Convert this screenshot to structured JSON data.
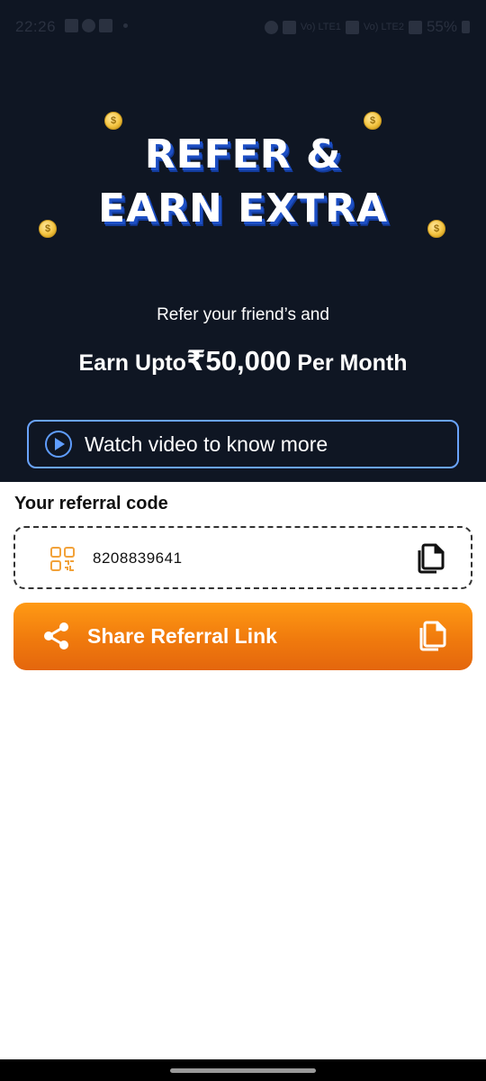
{
  "status_bar": {
    "time": "22:26",
    "battery": "55%",
    "network_labels": [
      "Vo) LTE1",
      "Vo) LTE2"
    ]
  },
  "hero": {
    "headline_line1": "REFER &",
    "headline_line2": "EARN EXTRA",
    "subtitle": "Refer your friend’s and",
    "earn_prefix": "Earn Upto",
    "earn_amount": "₹50,000",
    "earn_suffix": "Per Month",
    "video_button_label": "Watch video to know more",
    "coin_symbol": "$"
  },
  "referral": {
    "title": "Your referral code",
    "code": "8208839641",
    "share_button_label": "Share Referral Link"
  },
  "colors": {
    "hero_background": "#0f1623",
    "accent_blue": "#5f9dff",
    "share_orange": "#f07a0d",
    "qr_icon_orange": "#f2a23a"
  },
  "icons": [
    "play-icon",
    "qr-code-icon",
    "copy-icon",
    "share-icon",
    "coin-icon"
  ]
}
